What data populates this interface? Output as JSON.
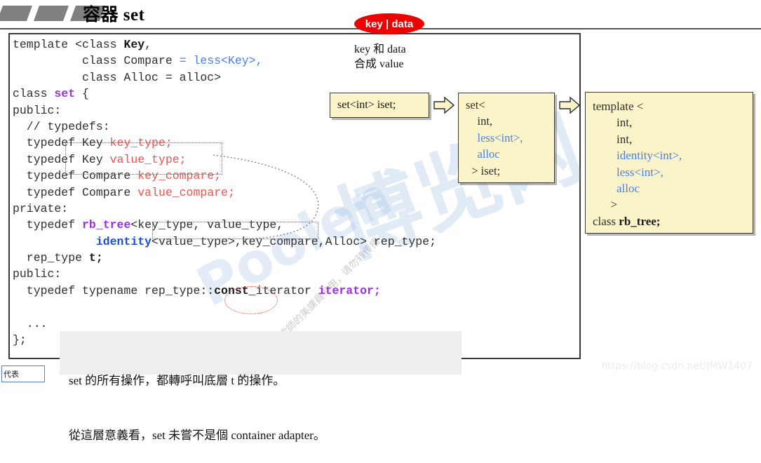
{
  "header": {
    "title": "容器 set",
    "decor_count": 3
  },
  "badge": {
    "label": "key | data",
    "color": "#ee0000"
  },
  "key_data_note": {
    "line1": "key 和 data",
    "line2": "合成 value"
  },
  "code": {
    "lines": [
      [
        {
          "t": "template <class ",
          "c": "plain"
        },
        {
          "t": "Key",
          "c": "bold"
        },
        {
          "t": ",",
          "c": "plain"
        }
      ],
      [
        {
          "t": "          class Compare ",
          "c": "plain"
        },
        {
          "t": "= less<Key>",
          "c": "blue"
        },
        {
          "t": ",",
          "c": "blue"
        }
      ],
      [
        {
          "t": "          class Alloc = alloc>",
          "c": "plain"
        }
      ],
      [
        {
          "t": "class ",
          "c": "plain"
        },
        {
          "t": "set",
          "c": "purple"
        },
        {
          "t": " {",
          "c": "plain"
        }
      ],
      [
        {
          "t": "public:",
          "c": "plain"
        }
      ],
      [
        {
          "t": "  // typedefs:",
          "c": "plain"
        }
      ],
      [
        {
          "t": "  typedef Key ",
          "c": "plain"
        },
        {
          "t": "key_type",
          "c": "red"
        },
        {
          "t": ";",
          "c": "red"
        }
      ],
      [
        {
          "t": "  typedef Key ",
          "c": "plain"
        },
        {
          "t": "value_type",
          "c": "red"
        },
        {
          "t": ";",
          "c": "red"
        }
      ],
      [
        {
          "t": "  typedef Compare ",
          "c": "plain"
        },
        {
          "t": "key_compare",
          "c": "red"
        },
        {
          "t": ";",
          "c": "red"
        }
      ],
      [
        {
          "t": "  typedef Compare ",
          "c": "plain"
        },
        {
          "t": "value_compare",
          "c": "red"
        },
        {
          "t": ";",
          "c": "red"
        }
      ],
      [
        {
          "t": "private:",
          "c": "plain"
        }
      ],
      [
        {
          "t": "  typedef ",
          "c": "plain"
        },
        {
          "t": "rb_tree",
          "c": "purple"
        },
        {
          "t": "<key_type, value_type,",
          "c": "plain"
        }
      ],
      [
        {
          "t": "            ",
          "c": "plain"
        },
        {
          "t": "identity",
          "c": "blueb"
        },
        {
          "t": "<value_type>,key_compare,Alloc> rep_type;",
          "c": "plain"
        }
      ],
      [
        {
          "t": "  rep_type ",
          "c": "plain"
        },
        {
          "t": "t",
          "c": "bold"
        },
        {
          "t": ";",
          "c": "bold"
        }
      ],
      [
        {
          "t": "public:",
          "c": "plain"
        }
      ],
      [
        {
          "t": "  typedef typename rep_type::",
          "c": "plain"
        },
        {
          "t": "const_",
          "c": "bold"
        },
        {
          "t": "iterator ",
          "c": "plain"
        },
        {
          "t": "iterator",
          "c": "purple"
        },
        {
          "t": ";",
          "c": "purple"
        }
      ],
      [
        {
          "t": "",
          "c": "plain"
        }
      ],
      [
        {
          "t": "  ...",
          "c": "plain"
        }
      ],
      [
        {
          "t": "};",
          "c": "plain"
        }
      ]
    ]
  },
  "boxes": {
    "iset": {
      "text": "set<int> iset;"
    },
    "set_full": {
      "lines": [
        [
          {
            "t": "set<",
            "c": "plain"
          }
        ],
        [
          {
            "t": "    int,",
            "c": "plain"
          }
        ],
        [
          {
            "t": "    ",
            "c": "plain"
          },
          {
            "t": "less<int>,",
            "c": "blue"
          }
        ],
        [
          {
            "t": "    ",
            "c": "plain"
          },
          {
            "t": "alloc",
            "c": "blue"
          }
        ],
        [
          {
            "t": "  > iset;",
            "c": "plain"
          }
        ]
      ]
    },
    "template_rbtree": {
      "lines": [
        [
          {
            "t": "template <",
            "c": "plain"
          }
        ],
        [
          {
            "t": "        ",
            "c": "plain"
          },
          {
            "t": "int,",
            "c": "plain"
          }
        ],
        [
          {
            "t": "        ",
            "c": "plain"
          },
          {
            "t": "int,",
            "c": "plain"
          }
        ],
        [
          {
            "t": "        ",
            "c": "plain"
          },
          {
            "t": "identity<int>,",
            "c": "blue"
          }
        ],
        [
          {
            "t": "        ",
            "c": "plain"
          },
          {
            "t": "less<int>,",
            "c": "blue"
          }
        ],
        [
          {
            "t": "        ",
            "c": "plain"
          },
          {
            "t": "alloc",
            "c": "blue"
          }
        ],
        [
          {
            "t": "      >",
            "c": "plain"
          }
        ],
        [
          {
            "t": "class ",
            "c": "plain"
          },
          {
            "t": "rb_tree;",
            "c": "bold"
          }
        ]
      ]
    }
  },
  "arrows": {
    "arrow1_name": "right-block-arrow",
    "arrow2_name": "right-block-arrow"
  },
  "bottom_note": {
    "line1": "set 的所有操作，都轉呼叫底層 t 的操作。",
    "line2": "從這層意義看，set 未嘗不是個 container adapter。"
  },
  "corner_box": {
    "text": "代表"
  },
  "watermarks": {
    "bolan": "博览网",
    "poolen": "Poolen",
    "small": "講義仅供授課教師的美課員专用，请勿转传播",
    "csdn": "https://blog.csdn.net/JMW1407"
  },
  "colors": {
    "badge_red": "#ee0000",
    "box_yellow": "#fbf4c8",
    "code_purple": "#9b30e0",
    "code_blue": "#4a7fe8",
    "code_red": "#f2524f",
    "frame_border": "#3a3a3a",
    "note_bg": "#eeeeee"
  }
}
